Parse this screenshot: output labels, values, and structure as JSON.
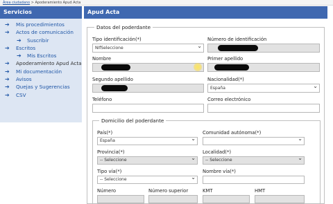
{
  "breadcrumb": {
    "home": "Área ciudadano",
    "separator": ">",
    "current": "Apoderamiento Apud Acta"
  },
  "sidebar": {
    "title": "Servicios",
    "items": [
      {
        "label": "Mis procedimientos"
      },
      {
        "label": "Actos de comunicación"
      },
      {
        "label": "Suscribir"
      },
      {
        "label": "Escritos"
      },
      {
        "label": "Mis Escritos"
      },
      {
        "label": "Apoderamiento Apud Acta"
      },
      {
        "label": "Mi documentación"
      },
      {
        "label": "Avisos"
      },
      {
        "label": "Quejas y Sugerencias"
      },
      {
        "label": "CSV"
      }
    ]
  },
  "main": {
    "title": "Apud Acta",
    "section1": {
      "legend": "Datos del poderdante",
      "tipo_id_label": "Tipo identificación(*)",
      "tipo_id_value": "NIfSeleccione",
      "num_id_label": "Número de identificación",
      "nombre_label": "Nombre",
      "primer_apellido_label": "Primer apellido",
      "segundo_apellido_label": "Segundo apellido",
      "nacionalidad_label": "Nacionalidad(*)",
      "nacionalidad_value": "España",
      "telefono_label": "Teléfono",
      "correo_label": "Correo electrónico"
    },
    "section2": {
      "legend": "Domicilio del poderdante",
      "pais_label": "País(*)",
      "pais_value": "España",
      "comunidad_label": "Comunidad autónoma(*)",
      "comunidad_value": "",
      "provincia_label": "Provincia(*)",
      "provincia_value": "-- Seleccione",
      "localidad_label": "Localidad(*)",
      "localidad_value": "-- Seleccione",
      "tipo_via_label": "Tipo vía(*)",
      "tipo_via_value": "-- Seleccione",
      "nombre_via_label": "Nombre vía(*)",
      "numero_label": "Número",
      "numero_superior_label": "Número superior",
      "kmt_label": "KMT",
      "hmt_label": "HMT"
    }
  },
  "colors": {
    "header": "#3f68b0",
    "sidebar_bg": "#dde6f3",
    "link": "#1f56a6",
    "readonly": "#e2e2e2"
  }
}
